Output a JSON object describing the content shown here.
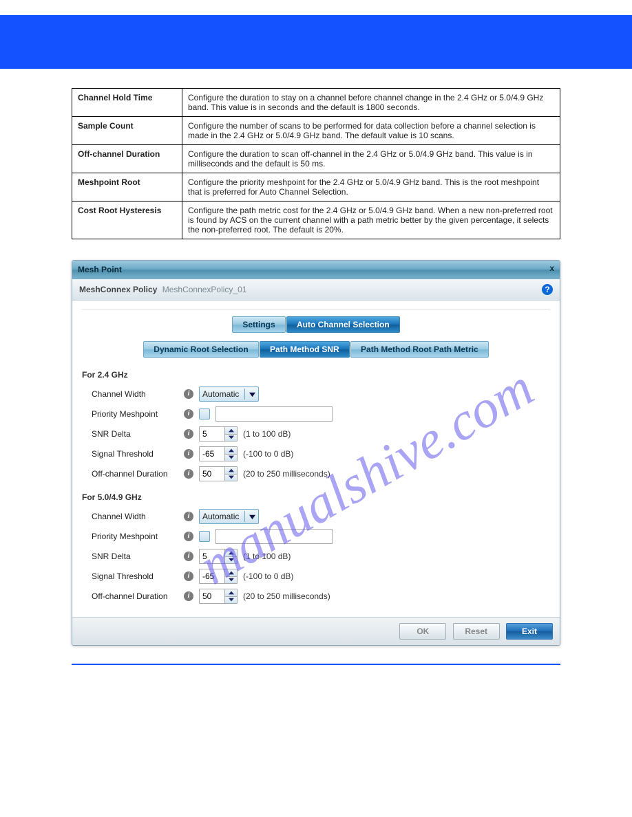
{
  "header_bar": {},
  "definitions": [
    {
      "term": "Channel Hold Time",
      "desc": "Configure the duration to stay on a channel before channel change in the 2.4 GHz or 5.0/4.9 GHz band. This value is in seconds and the default is 1800 seconds."
    },
    {
      "term": "Sample Count",
      "desc": "Configure the number of scans to be performed for data collection before a channel selection is made in the 2.4 GHz or 5.0/4.9 GHz band. The default value is 10 scans."
    },
    {
      "term": "Off-channel Duration",
      "desc": "Configure the duration to scan off-channel in the 2.4 GHz or 5.0/4.9 GHz band. This value is in milliseconds and the default is 50 ms."
    },
    {
      "term": "Meshpoint Root",
      "desc": "Configure the priority meshpoint for the 2.4 GHz or 5.0/4.9 GHz band. This is the root meshpoint that is preferred for Auto Channel Selection."
    },
    {
      "term": "Cost Root Hysteresis",
      "desc": "Configure the path metric cost for the 2.4 GHz or 5.0/4.9 GHz band. When a new non-preferred root is found by ACS on the current channel with a path metric better by the given percentage, it selects the non-preferred root. The default is 20%."
    }
  ],
  "watermark": "manualshive.com",
  "dialog": {
    "title": "Mesh Point",
    "close": "x",
    "policyLabel": "MeshConnex Policy",
    "policyName": "MeshConnexPolicy_01",
    "tabs1": {
      "settings": "Settings",
      "acs": "Auto Channel Selection"
    },
    "tabs2": {
      "drs": "Dynamic Root Selection",
      "snr": "Path Method SNR",
      "rpm": "Path Method Root Path Metric"
    },
    "section24": "For 2.4 GHz",
    "section50": "For 5.0/4.9 GHz",
    "labels": {
      "chwidth": "Channel Width",
      "priomp": "Priority Meshpoint",
      "snrdelta": "SNR Delta",
      "sigthr": "Signal Threshold",
      "offdur": "Off-channel Duration"
    },
    "channelWidthValue": "Automatic",
    "snrDeltaValue": "5",
    "snrDeltaHint": "(1 to 100 dB)",
    "sigThrValue": "-65",
    "sigThrHint": "(-100 to 0 dB)",
    "offDurValue": "50",
    "offDurHint": "(20 to 250 milliseconds)",
    "buttons": {
      "ok": "OK",
      "reset": "Reset",
      "exit": "Exit"
    }
  }
}
